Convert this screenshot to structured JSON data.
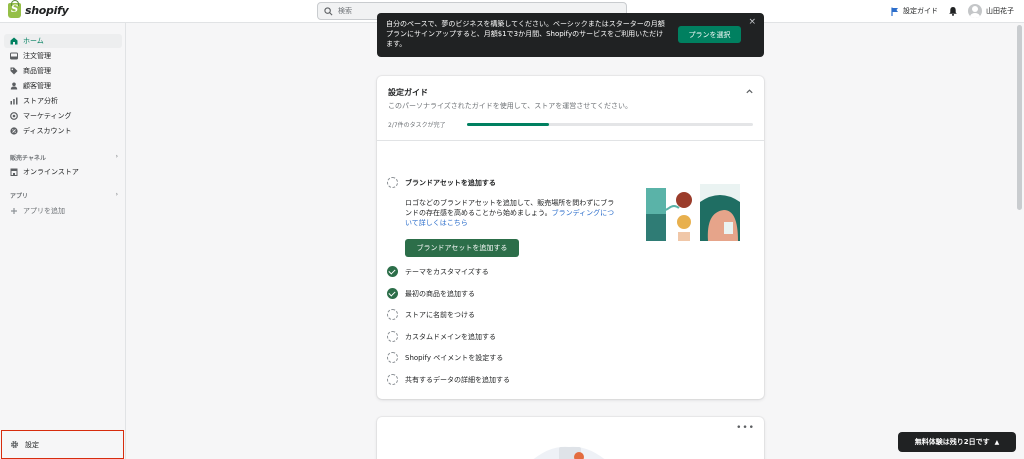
{
  "topbar": {
    "logo_text": "shopify",
    "search_placeholder": "検索",
    "setup_guide_label": "設定ガイド",
    "user_name": "山田花子"
  },
  "sidebar": {
    "items": [
      {
        "label": "ホーム",
        "icon": "home-icon",
        "active": true
      },
      {
        "label": "注文管理",
        "icon": "orders-icon"
      },
      {
        "label": "商品管理",
        "icon": "tag-icon"
      },
      {
        "label": "顧客管理",
        "icon": "customer-icon"
      },
      {
        "label": "ストア分析",
        "icon": "analytics-icon"
      },
      {
        "label": "マーケティング",
        "icon": "marketing-icon"
      },
      {
        "label": "ディスカウント",
        "icon": "discount-icon"
      }
    ],
    "sales_channels_label": "販売チャネル",
    "online_store_label": "オンラインストア",
    "apps_label": "アプリ",
    "add_app_label": "アプリを追加",
    "settings_label": "設定"
  },
  "banner": {
    "text": "自分のペースで、夢のビジネスを構築してください。ベーシックまたはスターターの月額プランにサインアップすると、月額$1で3か月間、Shopifyのサービスをご利用いただけます。",
    "button_label": "プランを選択",
    "close_symbol": "×"
  },
  "setup_guide": {
    "title": "設定ガイド",
    "description": "このパーソナライズされたガイドを使用して、ストアを運営させてください。",
    "progress_text": "2/7件のタスクが完了",
    "progress_fraction": 0.2857,
    "tasks": [
      {
        "label": "ブランドアセットを追加する",
        "done": false,
        "expanded": true
      },
      {
        "label": "テーマをカスタマイズする",
        "done": true
      },
      {
        "label": "最初の商品を追加する",
        "done": true
      },
      {
        "label": "ストアに名前をつける",
        "done": false
      },
      {
        "label": "カスタムドメインを追加する",
        "done": false
      },
      {
        "label": "Shopify ペイメントを設定する",
        "done": false
      },
      {
        "label": "共有するデータの詳細を追加する",
        "done": false
      }
    ],
    "expanded_body": "ロゴなどのブランドアセットを追加して、販売場所を問わずにブランドの存在感を高めることから始めましょう。",
    "expanded_link": "ブランディングについて詳しくはこちら",
    "expanded_button": "ブランドアセットを追加する"
  },
  "second_card": {
    "more_symbol": "•••"
  },
  "trial_badge": {
    "label": "無料体験は残り2日です",
    "caret": "▲"
  }
}
